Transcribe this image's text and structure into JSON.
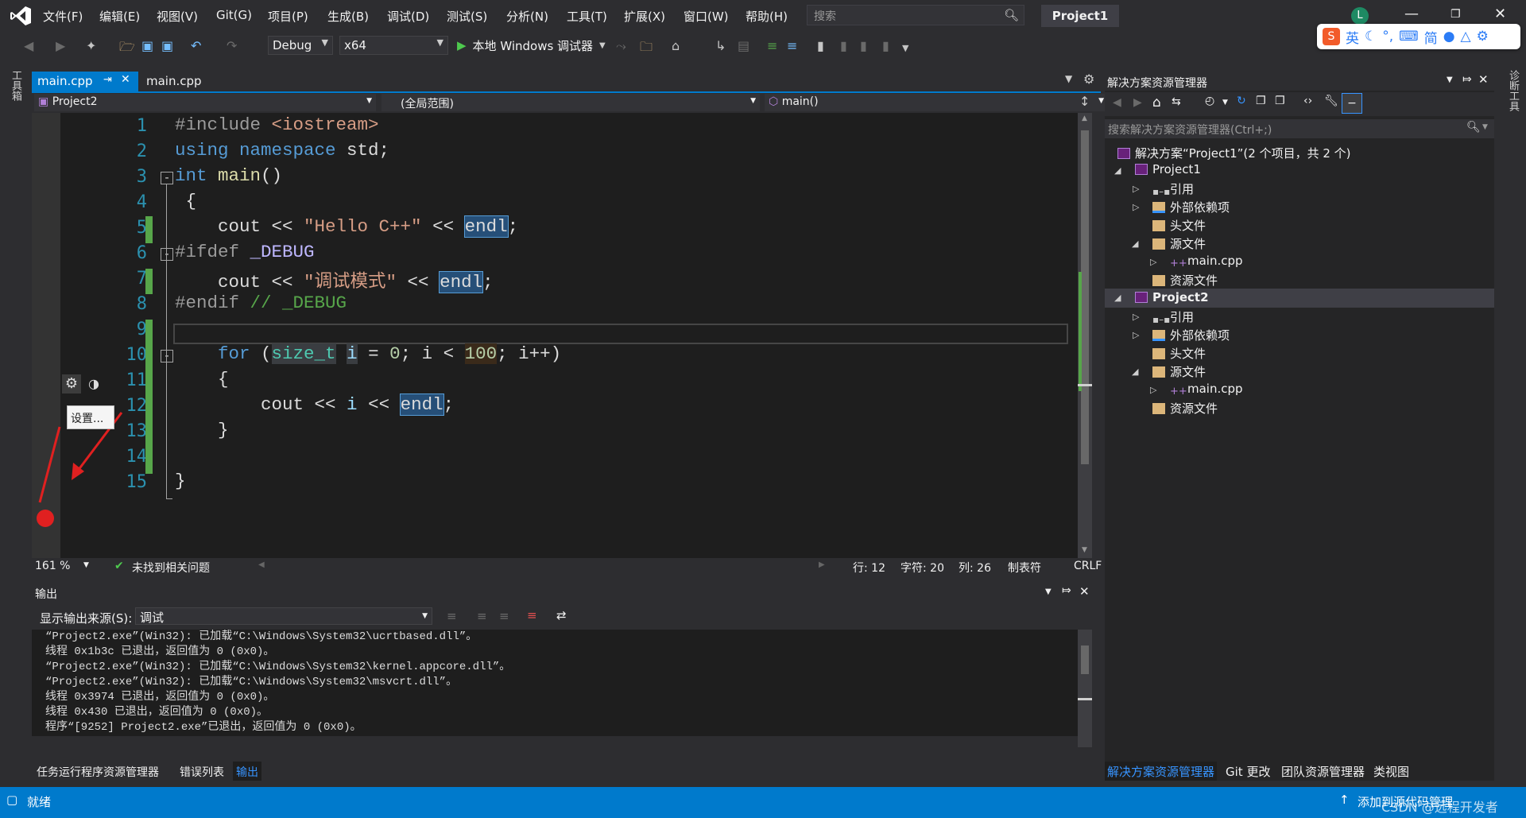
{
  "menu": [
    "文件(F)",
    "编辑(E)",
    "视图(V)",
    "Git(G)",
    "项目(P)",
    "生成(B)",
    "调试(D)",
    "测试(S)",
    "分析(N)",
    "工具(T)",
    "扩展(X)",
    "窗口(W)",
    "帮助(H)"
  ],
  "search": {
    "placeholder": "搜索"
  },
  "title": {
    "project": "Project1",
    "avatar": "L"
  },
  "ime": {
    "lang": "英",
    "mode": "简"
  },
  "toolbar": {
    "config": "Debug",
    "platform": "x64",
    "run": "本地 Windows 调试器"
  },
  "left_strip": {
    "label": "工具箱"
  },
  "right_strip": {
    "label": "诊断工具"
  },
  "tabs": {
    "active": "main.cpp",
    "second": "main.cpp"
  },
  "nav": {
    "project": "Project2",
    "scope": "(全局范围)",
    "member": "main()"
  },
  "code": {
    "line_numbers": [
      "1",
      "2",
      "3",
      "4",
      "5",
      "6",
      "7",
      "8",
      "9",
      "10",
      "11",
      "12",
      "13",
      "14",
      "15"
    ],
    "l1a": "#include ",
    "l1b": "<iostream>",
    "l2a": "using ",
    "l2b": "namespace ",
    "l2c": "std;",
    "l3a": "int ",
    "l3b": "main",
    "l3c": "()",
    "l4": " {",
    "l5a": "    cout << ",
    "l5b": "\"Hello C++\"",
    "l5c": " << ",
    "l5d": "endl",
    "l5e": ";",
    "l6a": "#ifdef ",
    "l6b": "_DEBUG",
    "l7a": "    cout << ",
    "l7b": "\"调试模式\"",
    "l7c": " << ",
    "l7d": "endl",
    "l7e": ";",
    "l8a": "#endif ",
    "l8b": "// _DEBUG",
    "l10a": "    for ",
    "l10b": "(",
    "l10c": "size_t",
    "l10d": " ",
    "l10e": "i",
    "l10f": " = ",
    "l10g": "0",
    "l10h": "; i < ",
    "l10i": "100",
    "l10j": "; i++)",
    "l11": "    {",
    "l12a": "        cout << ",
    "l12b": "i",
    "l12c": " << ",
    "l12d": "endl",
    "l12e": ";",
    "l13": "    }",
    "l15": "}"
  },
  "tooltip": "设置...",
  "editor_status": {
    "zoom": "161 %",
    "issues": "未找到相关问题",
    "line": "行: 12",
    "char": "字符: 20",
    "col": "列: 26",
    "tab": "制表符",
    "eol": "CRLF"
  },
  "output": {
    "title": "输出",
    "source_label": "显示输出来源(S):",
    "source_value": "调试",
    "lines": [
      "“Project2.exe”(Win32): 已加载“C:\\Windows\\System32\\ucrtbased.dll”。",
      "线程 0x1b3c 已退出，返回值为 0 (0x0)。",
      "“Project2.exe”(Win32): 已加载“C:\\Windows\\System32\\kernel.appcore.dll”。",
      "“Project2.exe”(Win32): 已加载“C:\\Windows\\System32\\msvcrt.dll”。",
      "线程 0x3974 已退出，返回值为 0 (0x0)。",
      "线程 0x430 已退出，返回值为 0 (0x0)。",
      "程序“[9252] Project2.exe”已退出，返回值为 0 (0x0)。"
    ]
  },
  "bottom_tabs": [
    "任务运行程序资源管理器",
    "错误列表",
    "输出"
  ],
  "se": {
    "title": "解决方案资源管理器",
    "search_placeholder": "搜索解决方案资源管理器(Ctrl+;)",
    "solution": "解决方案“Project1”(2 个项目，共 2 个)",
    "project1": "Project1",
    "ref": "引用",
    "ext": "外部依赖项",
    "headers": "头文件",
    "sources": "源文件",
    "maincpp": "main.cpp",
    "resources": "资源文件",
    "project2": "Project2"
  },
  "se_tabs": [
    "解决方案资源管理器",
    "Git 更改",
    "团队资源管理器",
    "类视图"
  ],
  "status": {
    "ready": "就绪",
    "source_control": "添加到源代码管理",
    "watermark": "CSDN @远程开发者"
  }
}
